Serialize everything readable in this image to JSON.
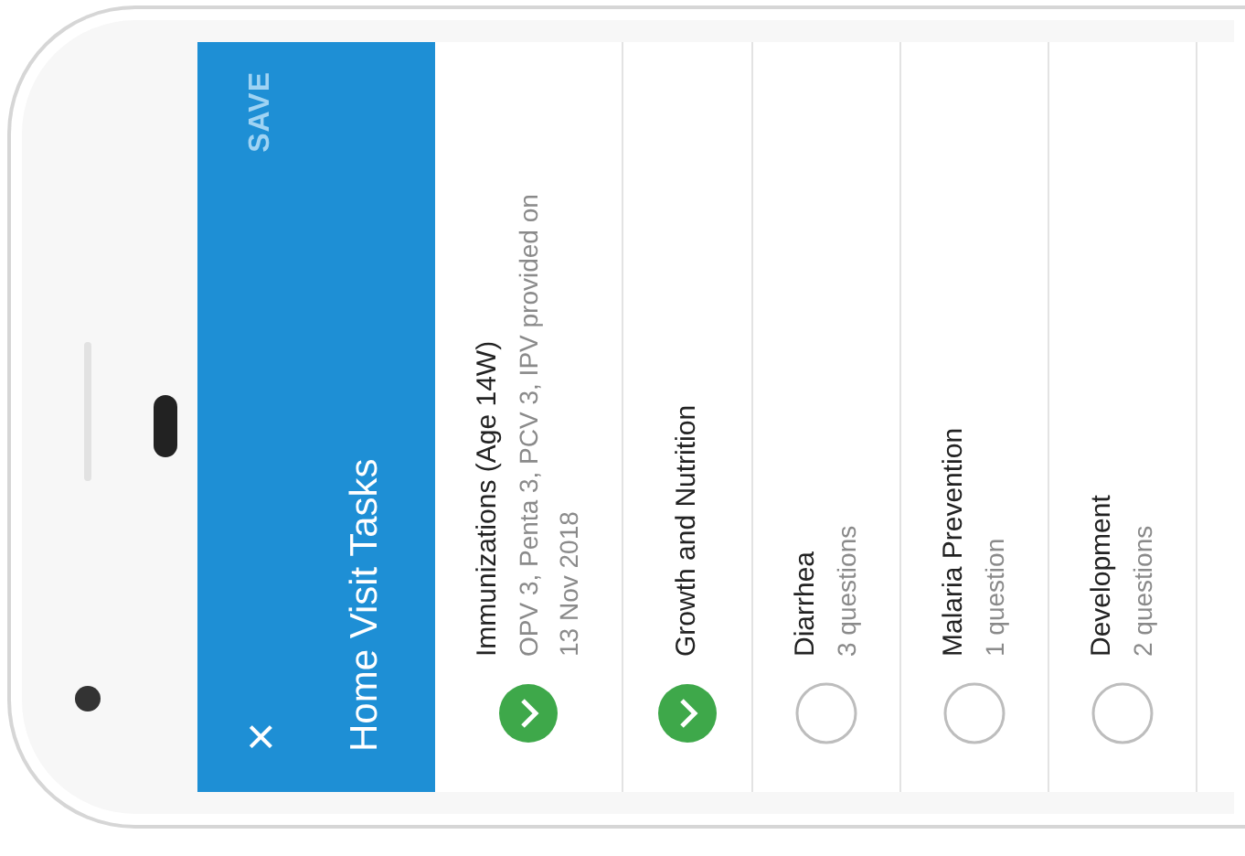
{
  "header": {
    "close": "×",
    "title": "Home Visit Tasks",
    "action": "SAVE"
  },
  "tasks": [
    {
      "title": "Immunizations (Age 14W)",
      "detail": "OPV 3, Penta 3, PCV 3, IPV provided on 13 Nov 2018",
      "done": true
    },
    {
      "title": "Growth and Nutrition",
      "done": true
    },
    {
      "title": "Diarrhea",
      "detail": "3 questions",
      "done": false
    },
    {
      "title": "Malaria Prevention",
      "detail": "1 question",
      "done": false
    },
    {
      "title": "Development",
      "detail": "2 questions",
      "done": false
    }
  ]
}
